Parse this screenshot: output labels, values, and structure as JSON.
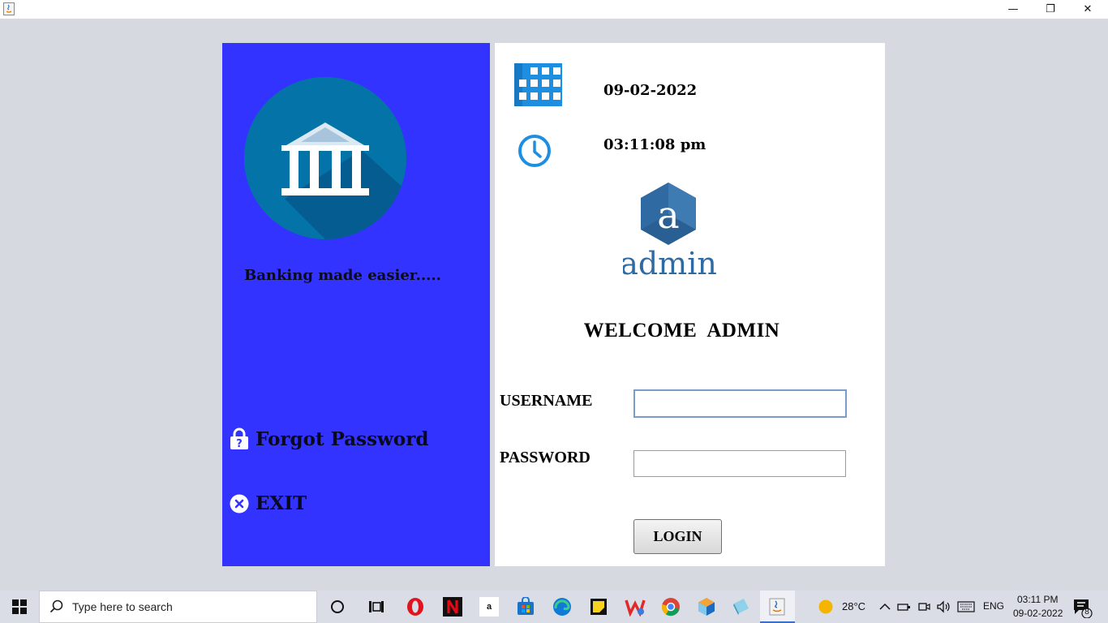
{
  "titlebar": {
    "minimize_glyph": "—",
    "restore_glyph": "❐",
    "close_glyph": "✕"
  },
  "sidebar": {
    "tagline": "Banking made easier.....",
    "forgot_password": "Forgot Password",
    "exit": "EXIT",
    "accent_color": "#3333ff"
  },
  "header": {
    "date": "09-02-2022",
    "time": "03:11:08 pm"
  },
  "admin_logo": {
    "letter": "a",
    "word": "admin"
  },
  "login": {
    "welcome": "WELCOME  ADMIN",
    "username_label": "USERNAME",
    "password_label": "PASSWORD",
    "username_value": "",
    "password_value": "",
    "button": "LOGIN"
  },
  "taskbar": {
    "search_placeholder": "Type here to search",
    "temperature": "28°C",
    "language": "ENG",
    "clock_time": "03:11 PM",
    "clock_date": "09-02-2022",
    "notification_count": "8",
    "pinned_apps": [
      "cortana-icon",
      "task-view-icon",
      "opera-icon",
      "netflix-icon",
      "amazon-icon",
      "microsoft-store-icon",
      "edge-icon",
      "sticky-notes-icon",
      "wps-icon",
      "chrome-icon",
      "netbeans-icon",
      "notepad-icon",
      "java-icon"
    ]
  }
}
